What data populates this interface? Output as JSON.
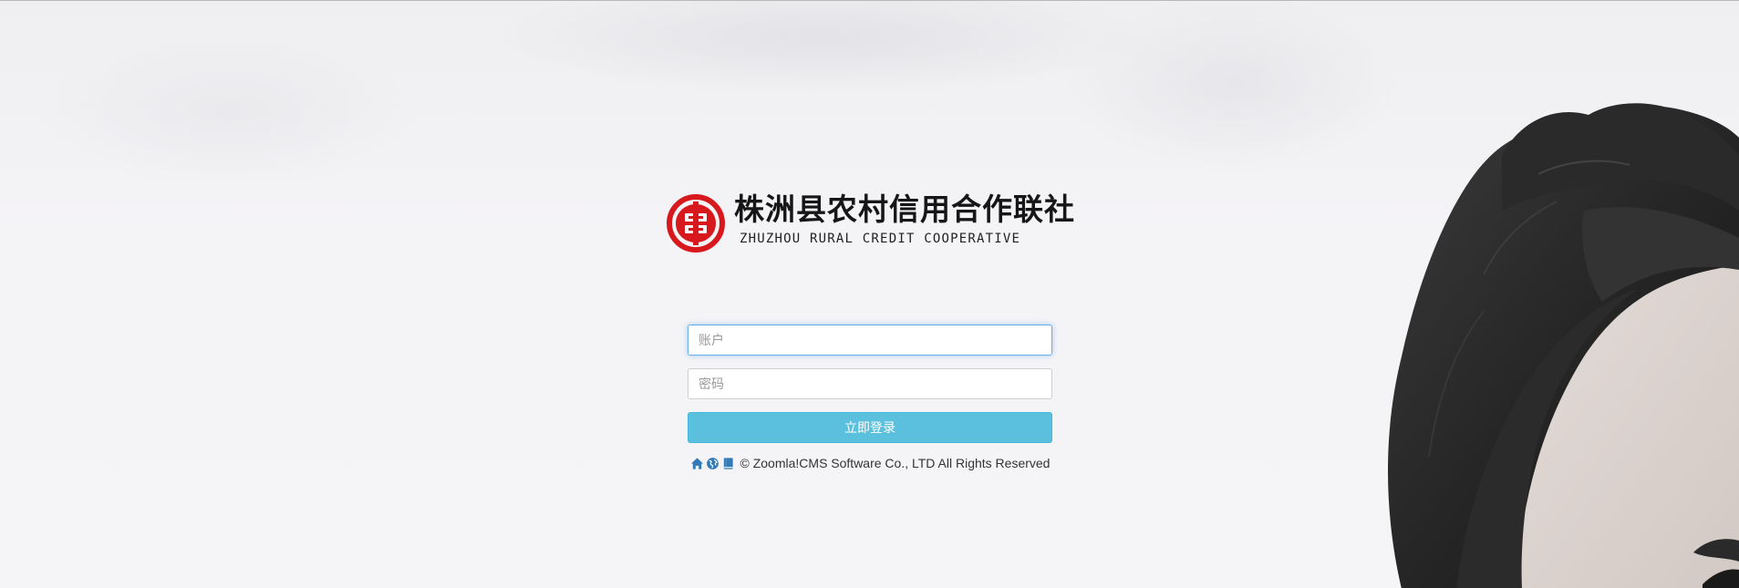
{
  "brand": {
    "name_cn": "株洲县农村信用合作联社",
    "name_en": "ZHUZHOU RURAL CREDIT COOPERATIVE",
    "logo_color": "#d7191d"
  },
  "login_form": {
    "account_placeholder": "账户",
    "account_value": "",
    "password_placeholder": "密码",
    "password_value": "",
    "submit_label": "立即登录",
    "button_color": "#5bc0de"
  },
  "footer": {
    "icons": [
      "home-icon",
      "globe-icon",
      "book-icon"
    ],
    "icon_color": "#337ab7",
    "copyright": "© Zoomla!CMS Software Co., LTD All Rights Reserved"
  }
}
